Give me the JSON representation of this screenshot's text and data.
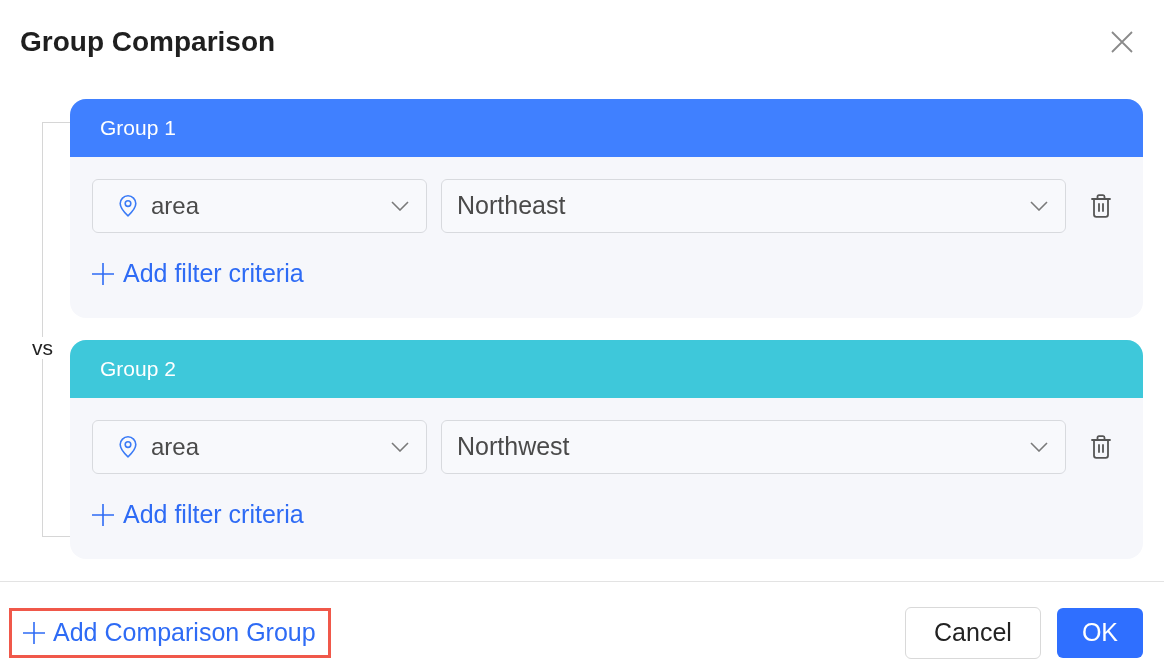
{
  "dialog": {
    "title": "Group Comparison"
  },
  "connector": {
    "label": "vs"
  },
  "groups": [
    {
      "title": "Group 1",
      "color": "#4080ff",
      "filters": [
        {
          "field": "area",
          "value": "Northeast"
        }
      ],
      "add_filter": "Add filter criteria"
    },
    {
      "title": "Group 2",
      "color": "#3ec8da",
      "filters": [
        {
          "field": "area",
          "value": "Northwest"
        }
      ],
      "add_filter": "Add filter criteria"
    }
  ],
  "footer": {
    "add_group": {
      "label": "Add Comparison Group",
      "highlighted": true
    },
    "buttons": [
      {
        "label": "Cancel",
        "kind": "secondary"
      },
      {
        "label": "OK",
        "kind": "primary"
      }
    ]
  }
}
